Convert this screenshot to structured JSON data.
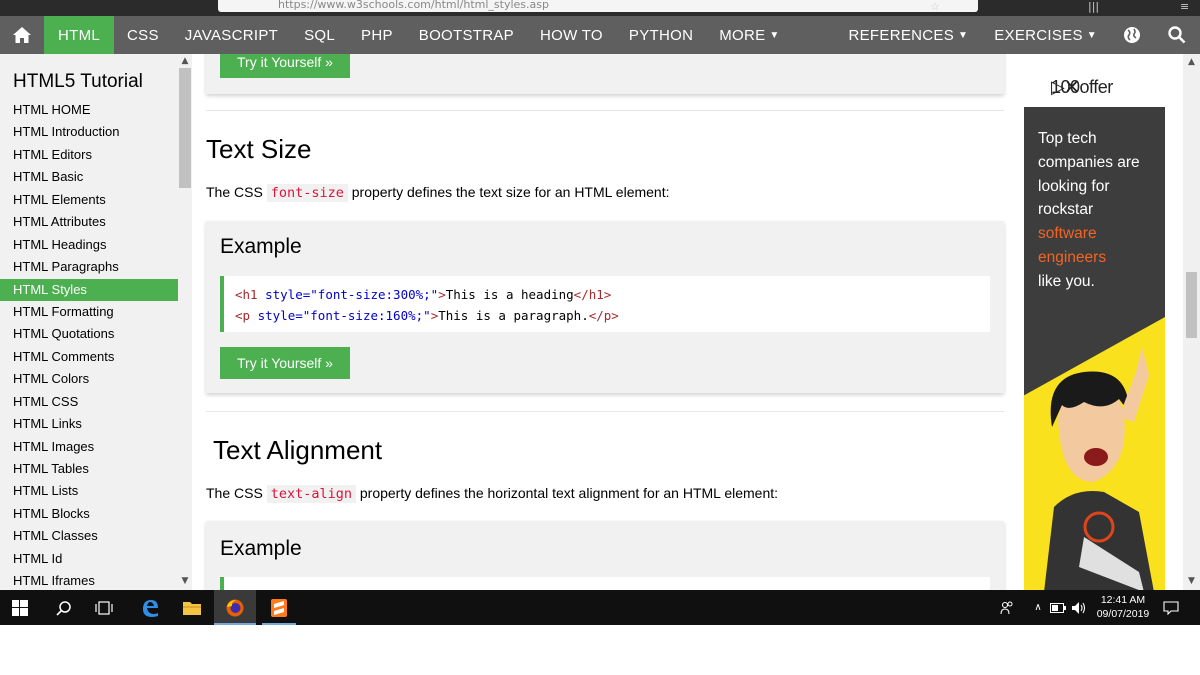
{
  "browser": {
    "url": "https://www.w3schools.com/html/html_styles.asp"
  },
  "topnav": {
    "items": [
      "HTML",
      "CSS",
      "JAVASCRIPT",
      "SQL",
      "PHP",
      "BOOTSTRAP",
      "HOW TO",
      "PYTHON",
      "MORE"
    ],
    "right_items": [
      "REFERENCES",
      "EXERCISES"
    ],
    "active": "HTML",
    "colors": {
      "bar": "#5f5f5f",
      "active": "#4caf50"
    }
  },
  "sidebar": {
    "title": "HTML5 Tutorial",
    "active": "HTML Styles",
    "items": [
      "HTML HOME",
      "HTML Introduction",
      "HTML Editors",
      "HTML Basic",
      "HTML Elements",
      "HTML Attributes",
      "HTML Headings",
      "HTML Paragraphs",
      "HTML Styles",
      "HTML Formatting",
      "HTML Quotations",
      "HTML Comments",
      "HTML Colors",
      "HTML CSS",
      "HTML Links",
      "HTML Images",
      "HTML Tables",
      "HTML Lists",
      "HTML Blocks",
      "HTML Classes",
      "HTML Id",
      "HTML Iframes"
    ]
  },
  "main": {
    "try_it_label": "Try it Yourself »",
    "section1": {
      "heading": "Text Size",
      "para_before": "The CSS ",
      "code": "font-size",
      "para_after": " property defines the text size for an HTML element:",
      "example_label": "Example",
      "code_lines": [
        {
          "open": "<h1",
          "attr": " style=",
          "val": "\"font-size:300%;\"",
          "close": ">",
          "text": "This is a heading",
          "end": "</h1>"
        },
        {
          "open": "<p",
          "attr": " style=",
          "val": "\"font-size:160%;\"",
          "close": ">",
          "text": "This is a paragraph.",
          "end": "</p>"
        }
      ]
    },
    "section2": {
      "heading": "Text Alignment",
      "para_before": "The CSS ",
      "code": "text-align",
      "para_after": " property defines the horizontal text alignment for an HTML element:",
      "example_label": "Example"
    }
  },
  "ad": {
    "brand": "100offer",
    "lines": [
      "Top tech",
      "companies are",
      "looking for",
      "rockstar"
    ],
    "highlight_lines": [
      "software",
      "engineers"
    ],
    "last_line": "like you.",
    "colors": {
      "bg": "#3d3d3d",
      "highlight": "#f26522",
      "yellow": "#f9e11e"
    }
  },
  "taskbar": {
    "time": "12:41 AM",
    "date": "09/07/2019"
  }
}
